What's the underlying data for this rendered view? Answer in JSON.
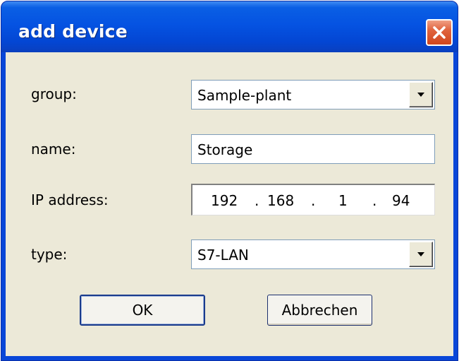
{
  "window": {
    "title": "add device",
    "close_icon": "close-icon"
  },
  "form": {
    "group": {
      "label": "group:",
      "value": "Sample-plant"
    },
    "name": {
      "label": "name:",
      "value": "Storage"
    },
    "ip": {
      "label": "IP address:",
      "octets": [
        "192",
        "168",
        "1",
        "94"
      ],
      "separator": "."
    },
    "type": {
      "label": "type:",
      "value": "S7-LAN"
    }
  },
  "buttons": {
    "ok": "OK",
    "cancel": "Abbrechen"
  },
  "colors": {
    "titlebar": "#0553e2",
    "close_button": "#e0633d",
    "client_background": "#ece9d8",
    "field_border": "#7f9db9"
  }
}
